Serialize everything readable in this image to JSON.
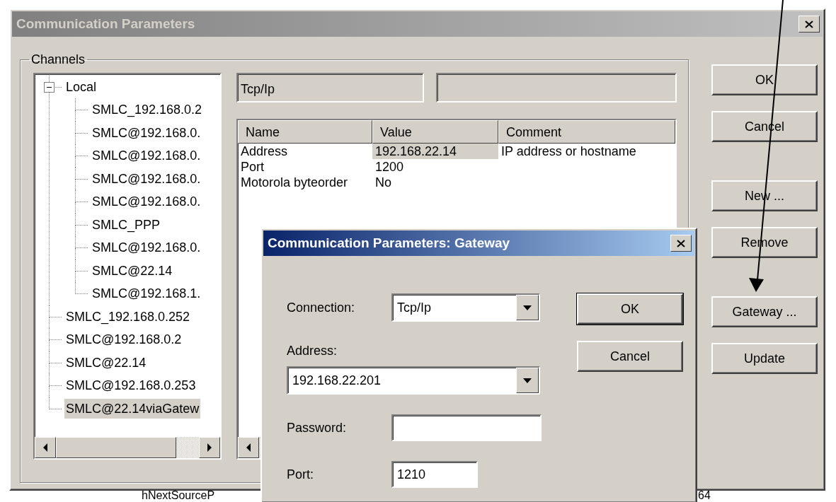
{
  "window": {
    "title": "Communication Parameters",
    "active": false
  },
  "channels": {
    "label": "Channels",
    "tree": [
      {
        "label": "Local",
        "expanded": true,
        "selected": false,
        "children": [
          {
            "label": "SMLC_192.168.0.2",
            "selected": false
          },
          {
            "label": "SMLC@192.168.0.",
            "selected": false
          },
          {
            "label": "SMLC@192.168.0.",
            "selected": false
          },
          {
            "label": "SMLC@192.168.0.",
            "selected": false
          },
          {
            "label": "SMLC@192.168.0.",
            "selected": false
          },
          {
            "label": "SMLC_PPP",
            "selected": false
          },
          {
            "label": "SMLC@192.168.0.",
            "selected": false
          },
          {
            "label": "SMLC@22.14",
            "selected": false
          },
          {
            "label": "SMLC@192.168.1.",
            "selected": false
          }
        ]
      },
      {
        "label": "SMLC_192.168.0.252",
        "selected": false
      },
      {
        "label": "SMLC@192.168.0.2",
        "selected": false
      },
      {
        "label": "SMLC@22.14",
        "selected": false
      },
      {
        "label": "SMLC@192.168.0.253",
        "selected": false
      },
      {
        "label": "SMLC@22.14viaGatew",
        "selected": true
      }
    ]
  },
  "protocol_field": {
    "value": "Tcp/Ip"
  },
  "parameters": {
    "columns": [
      "Name",
      "Value",
      "Comment"
    ],
    "rows": [
      {
        "name": "Address",
        "value": "192.168.22.14",
        "comment": "IP address or hostname",
        "selected": true
      },
      {
        "name": "Port",
        "value": "1200",
        "selected": false
      },
      {
        "name": "Motorola byteorder",
        "value": "No",
        "selected": false
      }
    ]
  },
  "buttons": [
    [
      "OK",
      "Cancel"
    ],
    [
      "New ...",
      "Remove"
    ],
    [
      "Gateway ...",
      "Update"
    ]
  ],
  "gateway_dialog": {
    "title": "Communication Parameters: Gateway",
    "active": true,
    "fields": [
      {
        "kind": "combo",
        "label": "Connection:",
        "value": "Tcp/Ip"
      },
      {
        "kind": "stackedcombo",
        "label": "Address:",
        "value": "192.168.22.201"
      },
      {
        "kind": "text",
        "label": "Password:"
      },
      {
        "kind": "text",
        "label": "Port:",
        "value": "1210"
      }
    ],
    "buttons": [
      {
        "label": "OK",
        "default": true
      },
      {
        "label": "Cancel",
        "default": false
      }
    ]
  },
  "background_texts": [
    "hNextSourceP",
    "64"
  ]
}
